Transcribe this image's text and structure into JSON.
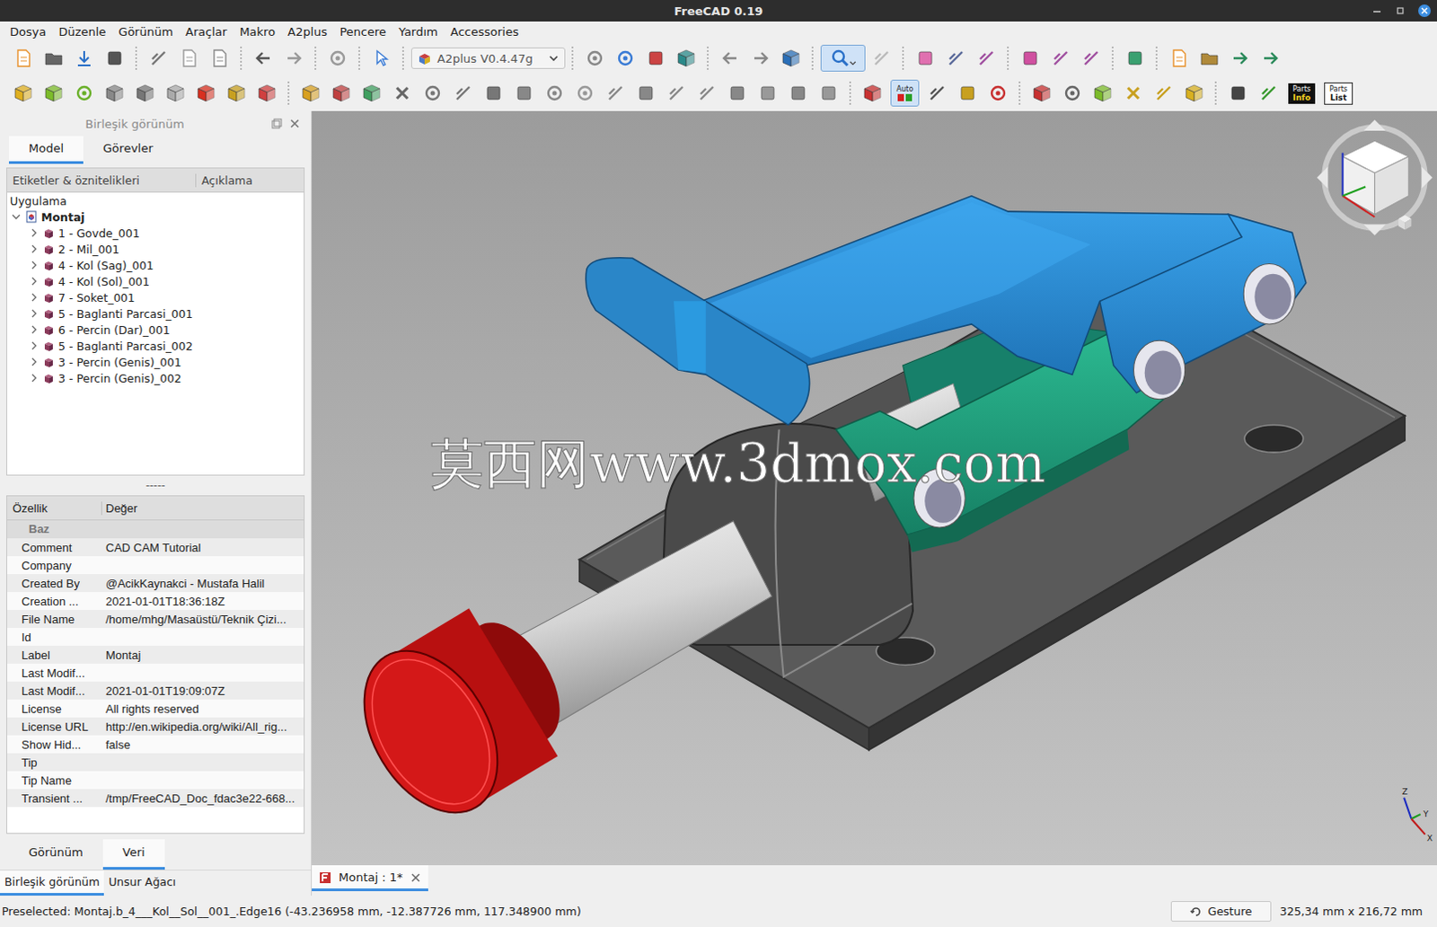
{
  "window": {
    "title": "FreeCAD 0.19"
  },
  "menu": [
    "Dosya",
    "Düzenle",
    "Görünüm",
    "Araçlar",
    "Makro",
    "A2plus",
    "Pencere",
    "Yardım",
    "Accessories"
  ],
  "toolbar": {
    "workbench": "A2plus V0.4.47g",
    "zoom_tool": {
      "selected": true
    },
    "auto_button": {
      "label": "Auto",
      "selected": true
    },
    "parts_info": [
      "Parts",
      "Info"
    ],
    "parts_list": [
      "Parts",
      "List"
    ]
  },
  "combo_view": {
    "title": "Birleşik görünüm",
    "tabs": [
      {
        "label": "Model",
        "selected": true
      },
      {
        "label": "Görevler",
        "selected": false
      }
    ]
  },
  "tree": {
    "columns": [
      "Etiketler & öznitelikleri",
      "Açıklama"
    ],
    "root": "Uygulama",
    "document": {
      "label": "Montaj",
      "expanded": true
    },
    "items": [
      {
        "label": "1 - Govde_001",
        "expanded": false
      },
      {
        "label": "2 - Mil_001",
        "expanded": false
      },
      {
        "label": "4 - Kol (Sag)_001",
        "expanded": false
      },
      {
        "label": "4 - Kol (Sol)_001",
        "expanded": false
      },
      {
        "label": "7 - Soket_001",
        "expanded": false
      },
      {
        "label": "5 - Baglanti Parcasi_001",
        "expanded": false
      },
      {
        "label": "6 - Percin (Dar)_001",
        "expanded": false
      },
      {
        "label": "5 - Baglanti Parcasi_002",
        "expanded": false
      },
      {
        "label": "3 - Percin (Genis)_001",
        "expanded": false
      },
      {
        "label": "3 - Percin (Genis)_002",
        "expanded": false
      }
    ]
  },
  "splitter": "-----",
  "properties": {
    "columns": [
      "Özellik",
      "Değer"
    ],
    "group": "Baz",
    "rows": [
      {
        "name": "Comment",
        "value": "CAD CAM Tutorial"
      },
      {
        "name": "Company",
        "value": ""
      },
      {
        "name": "Created By",
        "value": "@AcikKaynakci - Mustafa Halil"
      },
      {
        "name": "Creation ...",
        "value": "2021-01-01T18:36:18Z"
      },
      {
        "name": "File Name",
        "value": "/home/mhg/Masaüstü/Teknik Çizi..."
      },
      {
        "name": "Id",
        "value": ""
      },
      {
        "name": "Label",
        "value": "Montaj"
      },
      {
        "name": "Last Modif...",
        "value": ""
      },
      {
        "name": "Last Modif...",
        "value": "2021-01-01T19:09:07Z"
      },
      {
        "name": "License",
        "value": "All rights reserved"
      },
      {
        "name": "License URL",
        "value": "http://en.wikipedia.org/wiki/All_rig..."
      },
      {
        "name": "Show Hid...",
        "value": "false"
      },
      {
        "name": "Tip",
        "value": ""
      },
      {
        "name": "Tip Name",
        "value": ""
      },
      {
        "name": "Transient ...",
        "value": "/tmp/FreeCAD_Doc_fdac3e22-668..."
      }
    ]
  },
  "property_tabs": [
    {
      "label": "Görünüm",
      "selected": false
    },
    {
      "label": "Veri",
      "selected": true
    }
  ],
  "panel_tabs": [
    {
      "label": "Birleşik görünüm",
      "selected": true
    },
    {
      "label": "Unsur Ağacı",
      "selected": false
    }
  ],
  "viewport": {
    "watermark": "莫西网www.3dmox.com",
    "axes": [
      "Z",
      "Y",
      "X"
    ]
  },
  "document_tabs": [
    {
      "label": "Montaj : 1*",
      "selected": true
    }
  ],
  "status_bar": {
    "message": "Preselected: Montaj.b_4___Kol__Sol__001_.Edge16 (-43.236958 mm, -12.387726 mm, 117.348900 mm)",
    "navigation": "Gesture",
    "dimensions": "325,34 mm x 216,72 mm"
  }
}
